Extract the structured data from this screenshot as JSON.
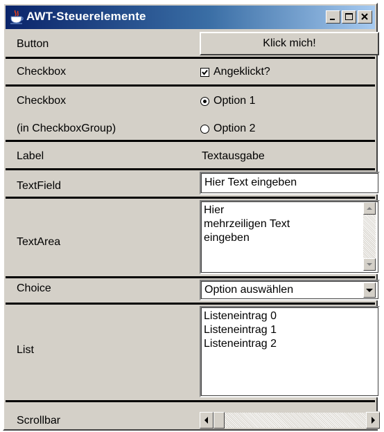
{
  "window": {
    "title": "AWT-Steuerelemente",
    "icon": "java-cup-icon",
    "controls": [
      "minimize-icon",
      "maximize-icon",
      "close-icon"
    ]
  },
  "rows": {
    "button": {
      "label": "Button",
      "button_text": "Klick mich!"
    },
    "checkbox": {
      "label": "Checkbox",
      "text": "Angeklickt?",
      "checked": true
    },
    "group": {
      "label": "Checkbox",
      "sublabel": "(in CheckboxGroup)",
      "options": [
        "Option 1",
        "Option 2"
      ],
      "selected": "Option 1"
    },
    "label": {
      "label": "Label",
      "text": "Textausgabe"
    },
    "textfield": {
      "label": "TextField",
      "value": "Hier Text eingeben"
    },
    "textarea": {
      "label": "TextArea",
      "lines": [
        "Hier",
        "mehrzeiligen Text",
        "eingeben"
      ]
    },
    "choice": {
      "label": "Choice",
      "selected": "Option auswählen"
    },
    "list": {
      "label": "List",
      "items": [
        "Listeneintrag 0",
        "Listeneintrag 1",
        "Listeneintrag 2"
      ]
    },
    "scrollbar": {
      "label": "Scrollbar"
    }
  },
  "colors": {
    "face": "#d4d0c8",
    "title_start": "#0a246a",
    "title_end": "#a6caf0"
  }
}
